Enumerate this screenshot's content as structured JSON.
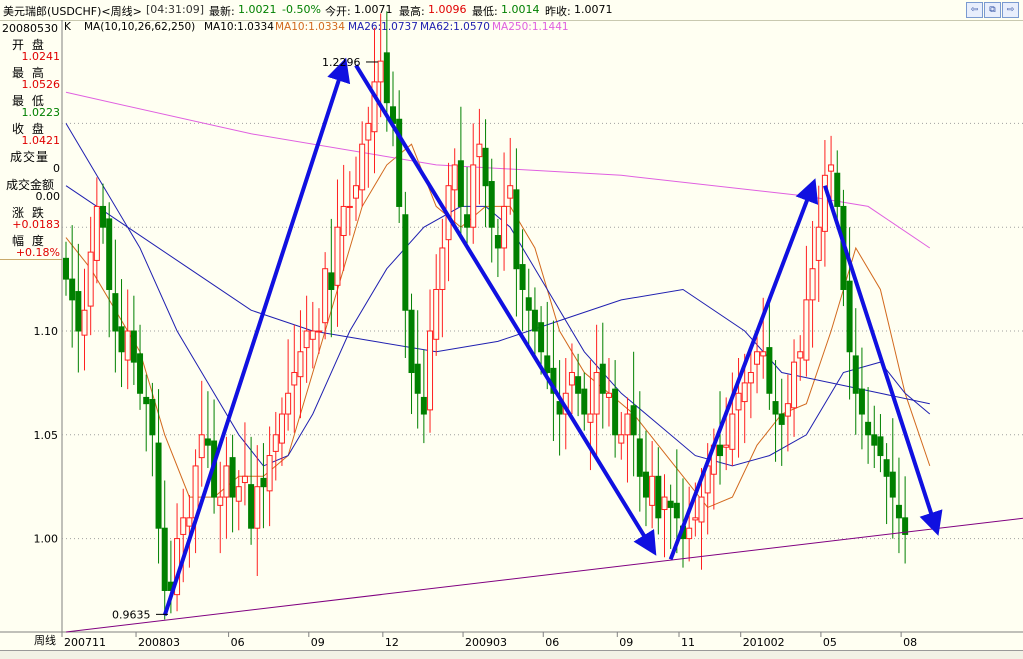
{
  "titlebar": {
    "instrument": "美元瑞郎(USDCHF)<周线>",
    "time": "[04:31:09]",
    "latest_label": "最新:",
    "latest": "1.0021",
    "change_pct": "-0.50%",
    "open_label": "今开:",
    "open": "1.0071",
    "high_label": "最高:",
    "high": "1.0096",
    "low_label": "最低:",
    "low": "1.0014",
    "prev_close_label": "昨收:",
    "prev_close": "1.0071"
  },
  "info_panel": {
    "date": "20080530",
    "open_label": "开 盘",
    "open": "1.0241",
    "high_label": "最 高",
    "high": "1.0526",
    "low_label": "最 低",
    "low": "1.0223",
    "close_label": "收 盘",
    "close": "1.0421",
    "volume_label": "成交量",
    "volume": "0",
    "amount_label": "成交金额",
    "amount": "0.00",
    "change_label": "涨 跌",
    "change": "+0.0183",
    "range_label": "幅 度",
    "range": "+0.18%"
  },
  "ma_header": {
    "k_label": "K",
    "params": "MA(10,10,26,62,250)",
    "ma10a": "MA10:1.0334",
    "ma10b": "MA10:1.0334",
    "ma26": "MA26:1.0737",
    "ma62": "MA62:1.0570",
    "ma250": "MA250:1.1441"
  },
  "colors": {
    "up": "#ff2020",
    "down": "#008000",
    "ma10": "#d2691e",
    "ma26": "#2020b0",
    "ma62": "#2020b0",
    "ma250": "#e060e0",
    "trend_arrows": "#1010e0",
    "support": "#800080",
    "grid": "#a0a0a0"
  },
  "chart_data": {
    "type": "candlestick",
    "title": "美元瑞郎(USDCHF)<周线>",
    "ylim": [
      0.955,
      1.245
    ],
    "y_ticks": [
      1.0,
      1.05,
      1.1
    ],
    "y_tick_labels": [
      "1.00",
      "1.05",
      "1.10"
    ],
    "x_axis_label": "周线",
    "x_tick_labels": [
      "200711",
      "200803",
      "06",
      "09",
      "12",
      "200903",
      "06",
      "09",
      "11",
      "201002",
      "05",
      "08"
    ],
    "annotations": [
      {
        "text": "1.2296",
        "value": 1.2296,
        "kind": "high"
      },
      {
        "text": "0.9635",
        "value": 0.9635,
        "kind": "low"
      }
    ],
    "price_walk": [
      1.125,
      1.115,
      1.1,
      1.11,
      1.138,
      1.16,
      1.15,
      1.12,
      1.1,
      1.09,
      1.1,
      1.085,
      1.07,
      1.065,
      1.05,
      1.005,
      0.975,
      0.975,
      1.0,
      1.01,
      1.01,
      1.035,
      1.05,
      1.045,
      1.02,
      1.02,
      1.035,
      1.02,
      1.025,
      1.03,
      1.005,
      1.025,
      1.025,
      1.04,
      1.05,
      1.06,
      1.07,
      1.08,
      1.09,
      1.1,
      1.1,
      1.1,
      1.13,
      1.12,
      1.15,
      1.16,
      1.16,
      1.17,
      1.19,
      1.2,
      1.22,
      1.23,
      1.21,
      1.2,
      1.16,
      1.11,
      1.08,
      1.07,
      1.06,
      1.1,
      1.12,
      1.14,
      1.17,
      1.18,
      1.16,
      1.15,
      1.18,
      1.19,
      1.17,
      1.15,
      1.14,
      1.16,
      1.17,
      1.13,
      1.12,
      1.11,
      1.1,
      1.09,
      1.08,
      1.07,
      1.06,
      1.07,
      1.08,
      1.07,
      1.06,
      1.06,
      1.08,
      1.07,
      1.07,
      1.05,
      1.05,
      1.06,
      1.05,
      1.03,
      1.02,
      1.03,
      1.01,
      1.02,
      1.015,
      1.01,
      1.0,
      1.005,
      1.01,
      1.02,
      1.035,
      1.045,
      1.04,
      1.045,
      1.06,
      1.07,
      1.075,
      1.08,
      1.09,
      1.09,
      1.07,
      1.06,
      1.055,
      1.065,
      1.085,
      1.09,
      1.115,
      1.13,
      1.15,
      1.175,
      1.18,
      1.16,
      1.12,
      1.09,
      1.07,
      1.06,
      1.05,
      1.045,
      1.04,
      1.03,
      1.02,
      1.01,
      1.002
    ],
    "moving_averages": {
      "MA10": [
        [
          0,
          1.145
        ],
        [
          4,
          1.13
        ],
        [
          8,
          1.11
        ],
        [
          12,
          1.09
        ],
        [
          16,
          1.05
        ],
        [
          20,
          1.02
        ],
        [
          24,
          1.02
        ],
        [
          28,
          1.03
        ],
        [
          32,
          1.03
        ],
        [
          36,
          1.04
        ],
        [
          40,
          1.08
        ],
        [
          44,
          1.12
        ],
        [
          48,
          1.16
        ],
        [
          52,
          1.18
        ],
        [
          56,
          1.19
        ],
        [
          60,
          1.16
        ],
        [
          64,
          1.15
        ],
        [
          68,
          1.16
        ],
        [
          72,
          1.16
        ],
        [
          76,
          1.14
        ],
        [
          80,
          1.1
        ],
        [
          84,
          1.08
        ],
        [
          88,
          1.07
        ],
        [
          92,
          1.06
        ],
        [
          96,
          1.045
        ],
        [
          100,
          1.03
        ],
        [
          104,
          1.015
        ],
        [
          108,
          1.02
        ],
        [
          112,
          1.045
        ],
        [
          116,
          1.06
        ],
        [
          120,
          1.065
        ],
        [
          124,
          1.1
        ],
        [
          128,
          1.14
        ],
        [
          132,
          1.12
        ],
        [
          136,
          1.07
        ],
        [
          140,
          1.035
        ]
      ],
      "MA26": [
        [
          0,
          1.2
        ],
        [
          6,
          1.17
        ],
        [
          12,
          1.14
        ],
        [
          18,
          1.1
        ],
        [
          24,
          1.07
        ],
        [
          28,
          1.05
        ],
        [
          32,
          1.035
        ],
        [
          36,
          1.04
        ],
        [
          40,
          1.06
        ],
        [
          46,
          1.1
        ],
        [
          52,
          1.13
        ],
        [
          58,
          1.15
        ],
        [
          64,
          1.16
        ],
        [
          68,
          1.16
        ],
        [
          72,
          1.15
        ],
        [
          78,
          1.12
        ],
        [
          84,
          1.09
        ],
        [
          90,
          1.07
        ],
        [
          96,
          1.055
        ],
        [
          102,
          1.04
        ],
        [
          108,
          1.035
        ],
        [
          114,
          1.04
        ],
        [
          120,
          1.05
        ],
        [
          126,
          1.08
        ],
        [
          132,
          1.085
        ],
        [
          136,
          1.07
        ],
        [
          140,
          1.06
        ]
      ],
      "MA62": [
        [
          0,
          1.17
        ],
        [
          10,
          1.15
        ],
        [
          20,
          1.13
        ],
        [
          30,
          1.11
        ],
        [
          40,
          1.1
        ],
        [
          50,
          1.095
        ],
        [
          60,
          1.09
        ],
        [
          70,
          1.095
        ],
        [
          80,
          1.105
        ],
        [
          90,
          1.115
        ],
        [
          100,
          1.12
        ],
        [
          110,
          1.1
        ],
        [
          116,
          1.08
        ],
        [
          124,
          1.075
        ],
        [
          132,
          1.07
        ],
        [
          140,
          1.065
        ]
      ],
      "MA250": [
        [
          0,
          1.215
        ],
        [
          30,
          1.195
        ],
        [
          60,
          1.18
        ],
        [
          90,
          1.175
        ],
        [
          120,
          1.165
        ],
        [
          130,
          1.16
        ],
        [
          140,
          1.14
        ]
      ]
    },
    "trend_lines": [
      {
        "from": [
          16,
          0.963
        ],
        "to": [
          45,
          1.228
        ]
      },
      {
        "from": [
          47,
          1.228
        ],
        "to": [
          95,
          0.995
        ]
      },
      {
        "from": [
          98,
          0.99
        ],
        "to": [
          121,
          1.17
        ]
      },
      {
        "from": [
          123,
          1.17
        ],
        "to": [
          141,
          1.005
        ]
      }
    ],
    "support_line": {
      "from": [
        0,
        0.955
      ],
      "to": [
        150,
        1.008
      ]
    }
  }
}
